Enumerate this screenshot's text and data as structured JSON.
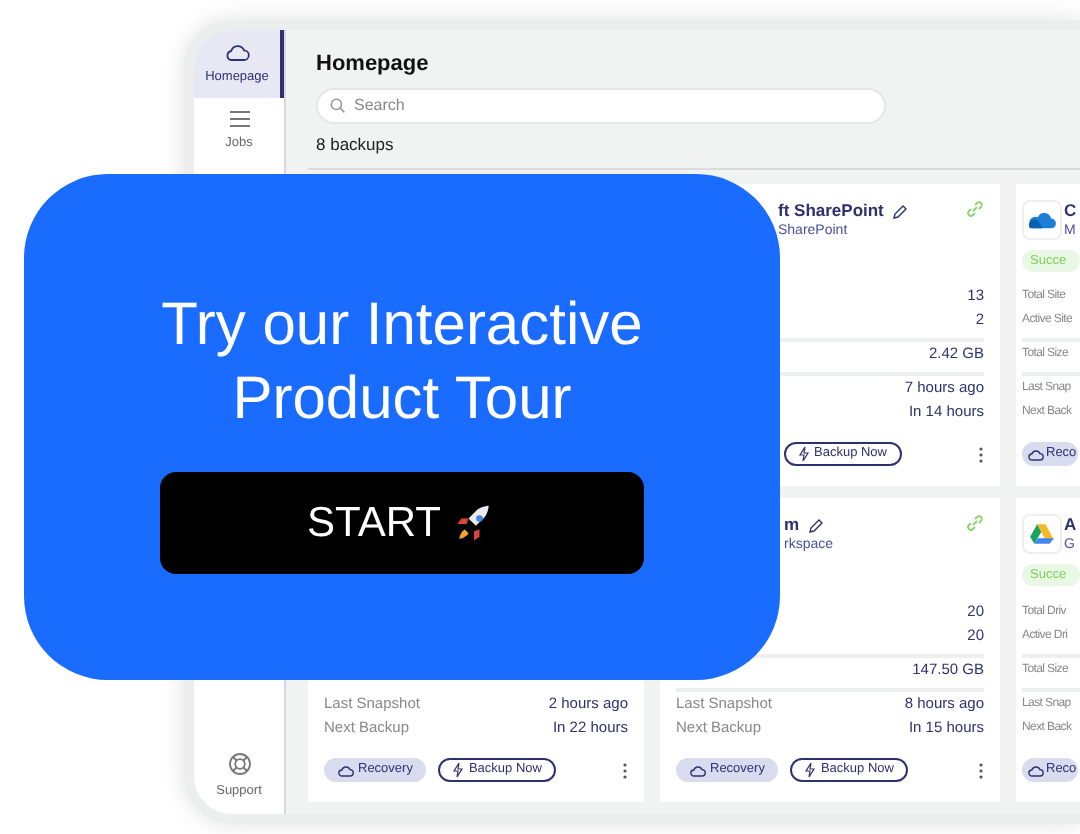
{
  "sidebar": {
    "items": [
      {
        "label": "Homepage",
        "selected": true
      },
      {
        "label": "Jobs",
        "selected": false
      }
    ],
    "footer_item": {
      "label": "Support"
    }
  },
  "header": {
    "title": "Homepage",
    "search": {
      "placeholder": "Search"
    },
    "count": "8 backups"
  },
  "cards": [
    {
      "kind": "covered",
      "title": "ft SharePoint",
      "subtitle": "SharePoint",
      "groups": [
        [
          {
            "value": "13"
          },
          {
            "value": "2"
          }
        ],
        [
          {
            "value": "2.42 GB"
          }
        ],
        [
          {
            "value": "7 hours ago"
          },
          {
            "value": "In 14 hours"
          }
        ]
      ],
      "buttons": [
        {
          "label": "Backup Now",
          "kind": "backup"
        }
      ]
    },
    {
      "kind": "edge",
      "logo": {
        "kind": "cloud"
      },
      "title": "C",
      "subtitle": "M",
      "badge": "Succe",
      "groups": [
        [
          {
            "label": "Total Site"
          },
          {
            "label": "Active Site"
          }
        ],
        [
          {
            "label": "Total Size"
          }
        ],
        [
          {
            "label": "Last Snap"
          },
          {
            "label": "Next Back"
          }
        ]
      ],
      "buttons": [
        {
          "label": "Reco",
          "kind": "recovery"
        }
      ]
    },
    {
      "kind": "bottom",
      "groups": [
        [
          {
            "label": "Last Snapshot",
            "value": "2 hours ago"
          },
          {
            "label": "Next Backup",
            "value": "In 22 hours"
          }
        ]
      ],
      "buttons": [
        {
          "label": "Recovery",
          "kind": "recovery"
        },
        {
          "label": "Backup Now",
          "kind": "backup"
        }
      ]
    },
    {
      "kind": "covered-top",
      "title": "m",
      "subtitle": "rkspace",
      "groups": [
        [
          {
            "value": "20"
          },
          {
            "value": "20"
          }
        ],
        [
          {
            "value": "147.50 GB"
          }
        ],
        [
          {
            "label": "Last Snapshot",
            "value": "8 hours ago"
          },
          {
            "label": "Next Backup",
            "value": "In 15 hours"
          }
        ]
      ],
      "buttons": [
        {
          "label": "Recovery",
          "kind": "recovery"
        },
        {
          "label": "Backup Now",
          "kind": "backup"
        }
      ]
    },
    {
      "kind": "edge",
      "logo": {
        "kind": "triangle"
      },
      "title": "A",
      "subtitle": "G",
      "badge": "Succe",
      "groups": [
        [
          {
            "label": "Total Driv"
          },
          {
            "label": "Active Dri"
          }
        ],
        [
          {
            "label": "Total Size"
          }
        ],
        [
          {
            "label": "Last Snap"
          },
          {
            "label": "Next Back"
          }
        ]
      ],
      "buttons": [
        {
          "label": "Reco",
          "kind": "recovery"
        }
      ]
    }
  ],
  "promo": {
    "title": "Try our Interactive Product Tour",
    "button": {
      "label": "START"
    }
  }
}
